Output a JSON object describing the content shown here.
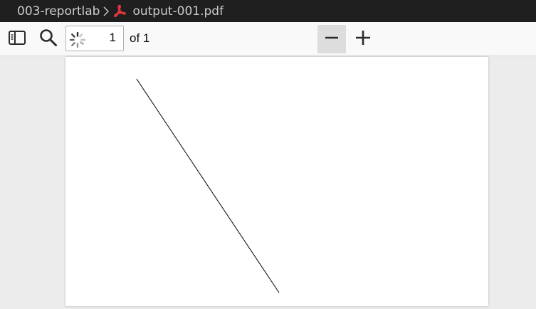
{
  "breadcrumb": {
    "folder": "003-reportlab",
    "file": "output-001.pdf"
  },
  "toolbar": {
    "current_page": "1",
    "page_count_label": "of 1",
    "icons": {
      "sidebar": "sidebar-toggle-icon",
      "search": "search-icon",
      "loading": "loading-spinner-icon",
      "zoom_out": "minus-icon",
      "zoom_in": "plus-icon",
      "file": "pdf-file-icon",
      "separator": "chevron-right-icon"
    }
  },
  "colors": {
    "breadcrumb_bg": "#1f1f1f",
    "breadcrumb_text": "#cccccc",
    "pdf_icon": "#e0383e",
    "toolbar_bg": "#f9f9fa",
    "viewer_bg": "#ececec",
    "page_bg": "#ffffff"
  }
}
